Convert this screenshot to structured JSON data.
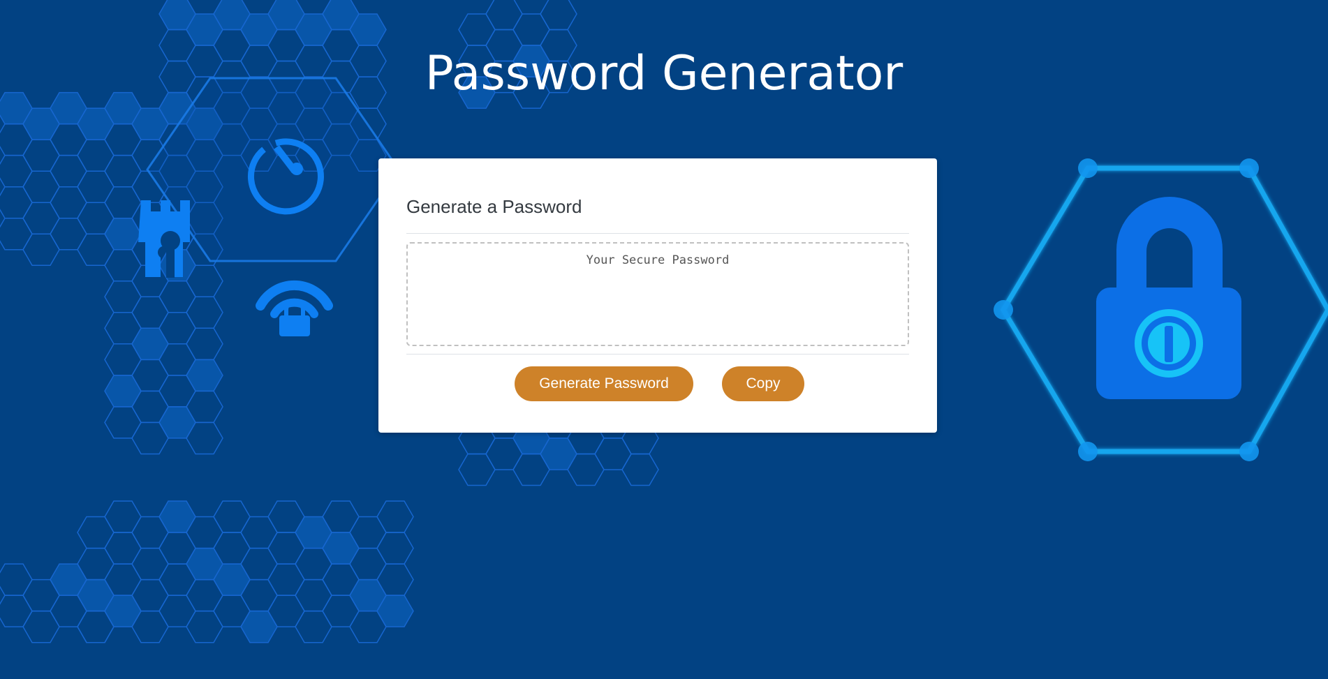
{
  "header": {
    "title": "Password Generator"
  },
  "card": {
    "title": "Generate a Password",
    "password": {
      "placeholder": "Your Secure Password",
      "value": ""
    },
    "buttons": {
      "generate_label": "Generate Password",
      "copy_label": "Copy"
    }
  },
  "background": {
    "icons": [
      "castle-tower-icon",
      "speedometer-icon",
      "wifi-lock-icon",
      "padlock-icon"
    ]
  },
  "colors": {
    "background": "#024283",
    "accent_button": "#ce8229",
    "hex_line": "#1a6fd6",
    "hex_glow": "#16b6f2",
    "icon_blue": "#0e7ff2"
  }
}
